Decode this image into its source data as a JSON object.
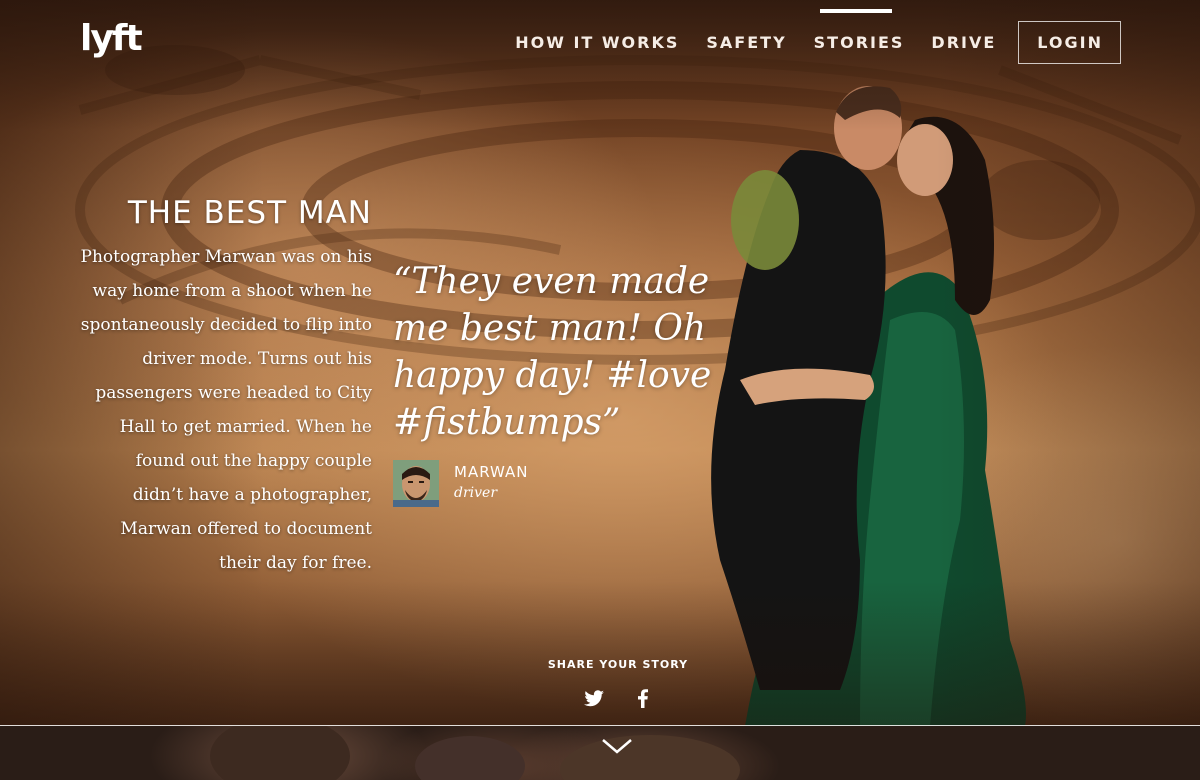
{
  "brand": {
    "logo_icon": "lyft-logo-icon",
    "logo_text": "lyft"
  },
  "nav": {
    "items": [
      {
        "label": "HOW IT WORKS",
        "active": false
      },
      {
        "label": "SAFETY",
        "active": false
      },
      {
        "label": "STORIES",
        "active": true
      },
      {
        "label": "DRIVE",
        "active": false
      }
    ],
    "login_label": "LOGIN"
  },
  "story": {
    "title": "THE BEST MAN",
    "body": "Photographer Marwan was on his way home from a shoot when he spontaneously decided to flip into driver mode. Turns out his passengers were headed to City Hall to get married. When he found out the happy couple didn’t have a photographer, Marwan offered to document their day for free.",
    "quote": "“They even made me best man! Oh happy day! #love #fistbumps”",
    "author_name": "MARWAN",
    "author_role": "driver"
  },
  "share": {
    "label": "SHARE YOUR STORY",
    "icons": [
      "twitter-icon",
      "facebook-icon"
    ]
  },
  "scroll": {
    "icon": "chevron-down-icon"
  },
  "colors": {
    "text": "#ffffff",
    "hero_bg": "#9a6238",
    "bottom_bg": "#2a1d17"
  }
}
